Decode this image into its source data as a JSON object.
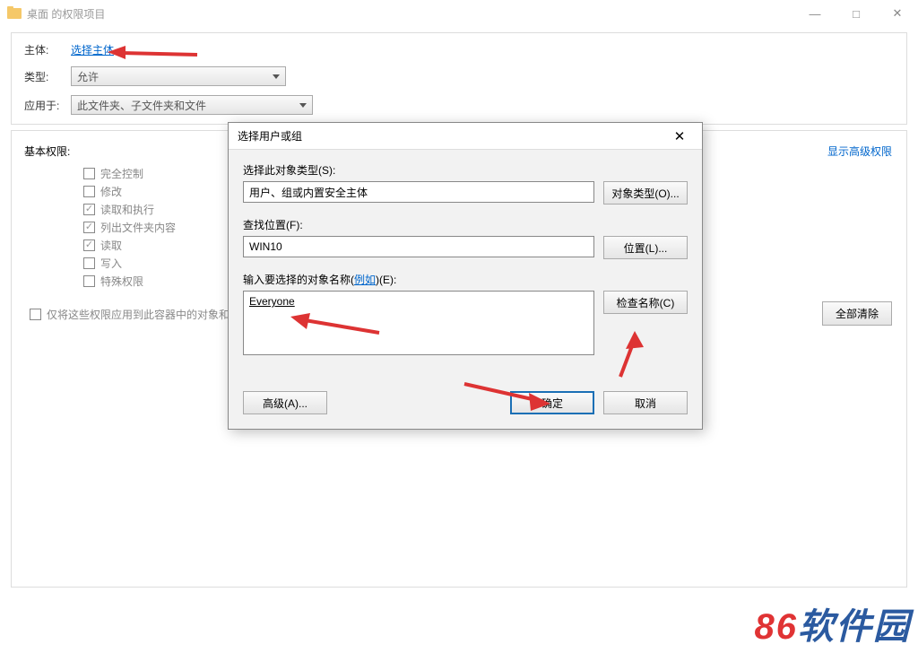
{
  "window": {
    "title": "桌面 的权限项目",
    "minimize": "—",
    "maximize": "□",
    "close": "✕"
  },
  "header": {
    "principal_label": "主体:",
    "principal_link": "选择主体",
    "type_label": "类型:",
    "type_value": "允许",
    "applies_label": "应用于:",
    "applies_value": "此文件夹、子文件夹和文件"
  },
  "permissions": {
    "title": "基本权限:",
    "advanced_link": "显示高级权限",
    "items": [
      {
        "label": "完全控制",
        "checked": false,
        "grayed": true
      },
      {
        "label": "修改",
        "checked": false,
        "grayed": true
      },
      {
        "label": "读取和执行",
        "checked": true,
        "grayed": true
      },
      {
        "label": "列出文件夹内容",
        "checked": true,
        "grayed": true
      },
      {
        "label": "读取",
        "checked": true,
        "grayed": true
      },
      {
        "label": "写入",
        "checked": false,
        "grayed": true
      },
      {
        "label": "特殊权限",
        "checked": false,
        "grayed": true
      }
    ],
    "only_container_label": "仅将这些权限应用到此容器中的对象和",
    "clear_all": "全部清除"
  },
  "dialog": {
    "title": "选择用户或组",
    "object_type_label": "选择此对象类型(S):",
    "object_type_value": "用户、组或内置安全主体",
    "object_type_btn": "对象类型(O)...",
    "location_label": "查找位置(F):",
    "location_value": "WIN10",
    "location_btn": "位置(L)...",
    "name_label_prefix": "输入要选择的对象名称(",
    "name_label_example": "例如",
    "name_label_suffix": ")(E):",
    "name_value": "Everyone",
    "check_name_btn": "检查名称(C)",
    "advanced_btn": "高级(A)...",
    "ok_btn": "确定",
    "cancel_btn": "取消"
  },
  "watermark": {
    "part1": "86",
    "part2": "软件园"
  }
}
